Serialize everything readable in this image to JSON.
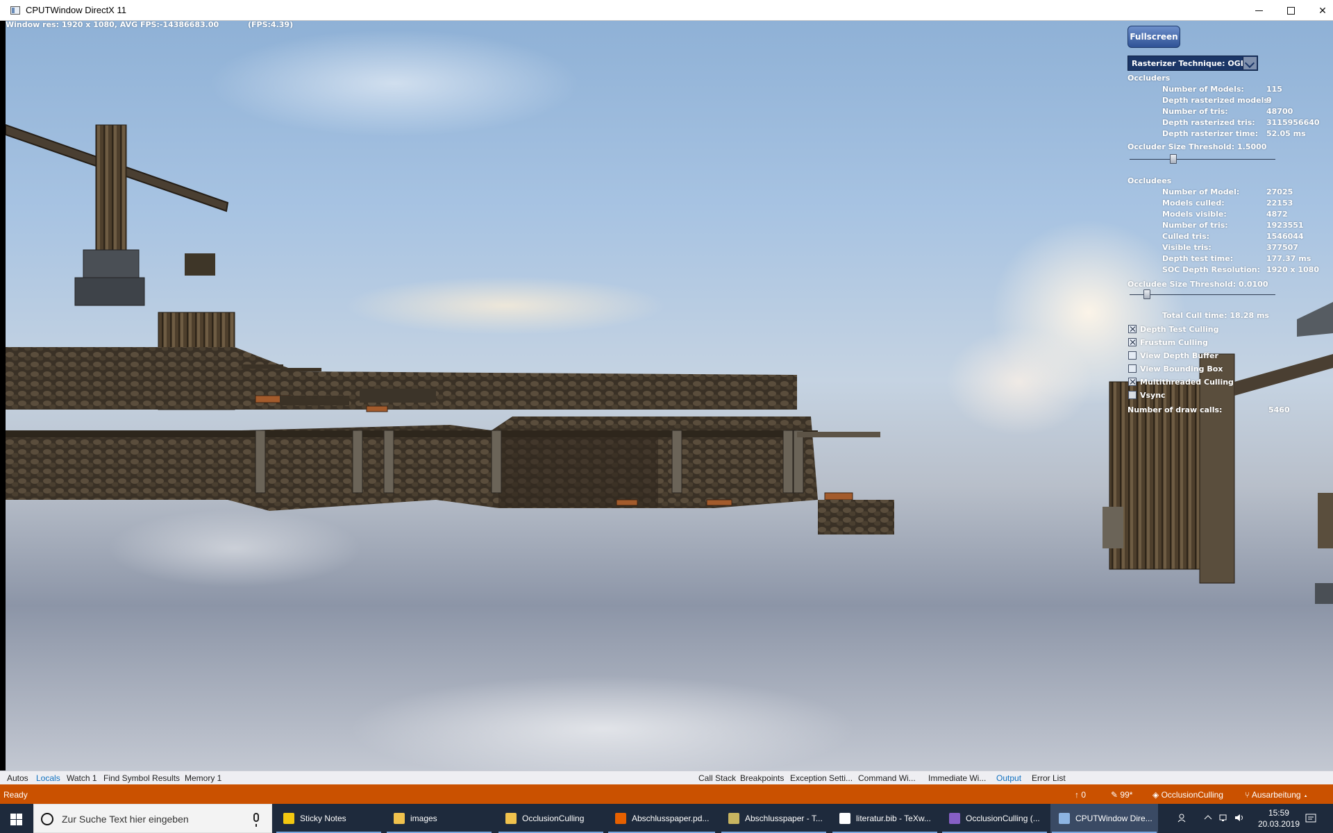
{
  "window": {
    "title": "CPUTWindow DirectX 11"
  },
  "hud": {
    "resolution_text": "Window res: 1920 x 1080, AVG FPS:-14386683.00",
    "fps_text": "(FPS:4.39)",
    "fullscreen_label": "Fullscreen",
    "rasterizer_label": "Rasterizer Technique: OGL",
    "occluders": {
      "heading": "Occluders",
      "stats": [
        {
          "label": "Number of Models:",
          "value": "115"
        },
        {
          "label": "Depth rasterized models:",
          "value": "9"
        },
        {
          "label": "Number of tris:",
          "value": "48700"
        },
        {
          "label": "Depth rasterized tris:",
          "value": "3115956640"
        },
        {
          "label": "Depth rasterizer time:",
          "value": "52.05 ms"
        }
      ],
      "threshold_label": "Occluder Size Threshold: 1.5000",
      "threshold_position": 0.3
    },
    "occludees": {
      "heading": "Occludees",
      "stats": [
        {
          "label": "Number of Model:",
          "value": "27025"
        },
        {
          "label": "Models culled:",
          "value": "22153"
        },
        {
          "label": "Models visible:",
          "value": "4872"
        },
        {
          "label": "Number of tris:",
          "value": "1923551"
        },
        {
          "label": "Culled tris:",
          "value": "1546044"
        },
        {
          "label": "Visible tris:",
          "value": "377507"
        },
        {
          "label": "Depth test time:",
          "value": "177.37 ms"
        },
        {
          "label": "SOC Depth Resolution:",
          "value": "1920 x 1080"
        }
      ],
      "threshold_label": "Occludee Size Threshold: 0.0100",
      "threshold_position": 0.12
    },
    "total_cull_time": "Total Cull time: 18.28 ms",
    "options": [
      {
        "label": "Depth Test Culling",
        "checked": true
      },
      {
        "label": "Frustum Culling",
        "checked": true
      },
      {
        "label": "View Depth Buffer",
        "checked": false
      },
      {
        "label": "View Bounding Box",
        "checked": false
      },
      {
        "label": "Multithreaded Culling",
        "checked": true
      },
      {
        "label": "Vsync",
        "checked": false
      }
    ],
    "draw_calls_label": "Number of draw calls:",
    "draw_calls_value": "5460"
  },
  "debug_tabs_left": [
    {
      "label": "Autos",
      "active": false
    },
    {
      "label": "Locals",
      "active": true
    },
    {
      "label": "Watch 1",
      "active": false
    },
    {
      "label": "Find Symbol Results",
      "active": false
    },
    {
      "label": "Memory 1",
      "active": false
    }
  ],
  "debug_tabs_right": [
    {
      "label": "Call Stack",
      "active": false
    },
    {
      "label": "Breakpoints",
      "active": false
    },
    {
      "label": "Exception Setti...",
      "active": false
    },
    {
      "label": "Command Wi...",
      "active": false
    },
    {
      "label": "Immediate Wi...",
      "active": false
    },
    {
      "label": "Output",
      "active": true
    },
    {
      "label": "Error List",
      "active": false
    }
  ],
  "statusbar": {
    "ready": "Ready",
    "errors": "0",
    "edits": "99*",
    "repo": "OcclusionCulling",
    "branch": "Ausarbeitung"
  },
  "taskbar": {
    "search_placeholder": "Zur Suche Text hier eingeben",
    "apps": [
      {
        "label": "Sticky Notes",
        "icon": "sticky-notes-icon",
        "color": "#f2c811",
        "active": false
      },
      {
        "label": "images",
        "icon": "folder-icon",
        "color": "#f0c24d",
        "active": false
      },
      {
        "label": "OcclusionCulling",
        "icon": "folder-icon",
        "color": "#f0c24d",
        "active": false
      },
      {
        "label": "Abschlusspaper.pd...",
        "icon": "firefox-icon",
        "color": "#e66000",
        "active": false
      },
      {
        "label": "Abschlusspaper - T...",
        "icon": "texmaker-icon",
        "color": "#c8b560",
        "active": false
      },
      {
        "label": "literatur.bib - TeXw...",
        "icon": "document-icon",
        "color": "#ffffff",
        "active": false
      },
      {
        "label": "OcclusionCulling (...",
        "icon": "visual-studio-icon",
        "color": "#865fc5",
        "active": false
      },
      {
        "label": "CPUTWindow Dire...",
        "icon": "window-icon",
        "color": "#8db4e2",
        "active": true
      }
    ],
    "time": "15:59",
    "date": "20.03.2019"
  }
}
